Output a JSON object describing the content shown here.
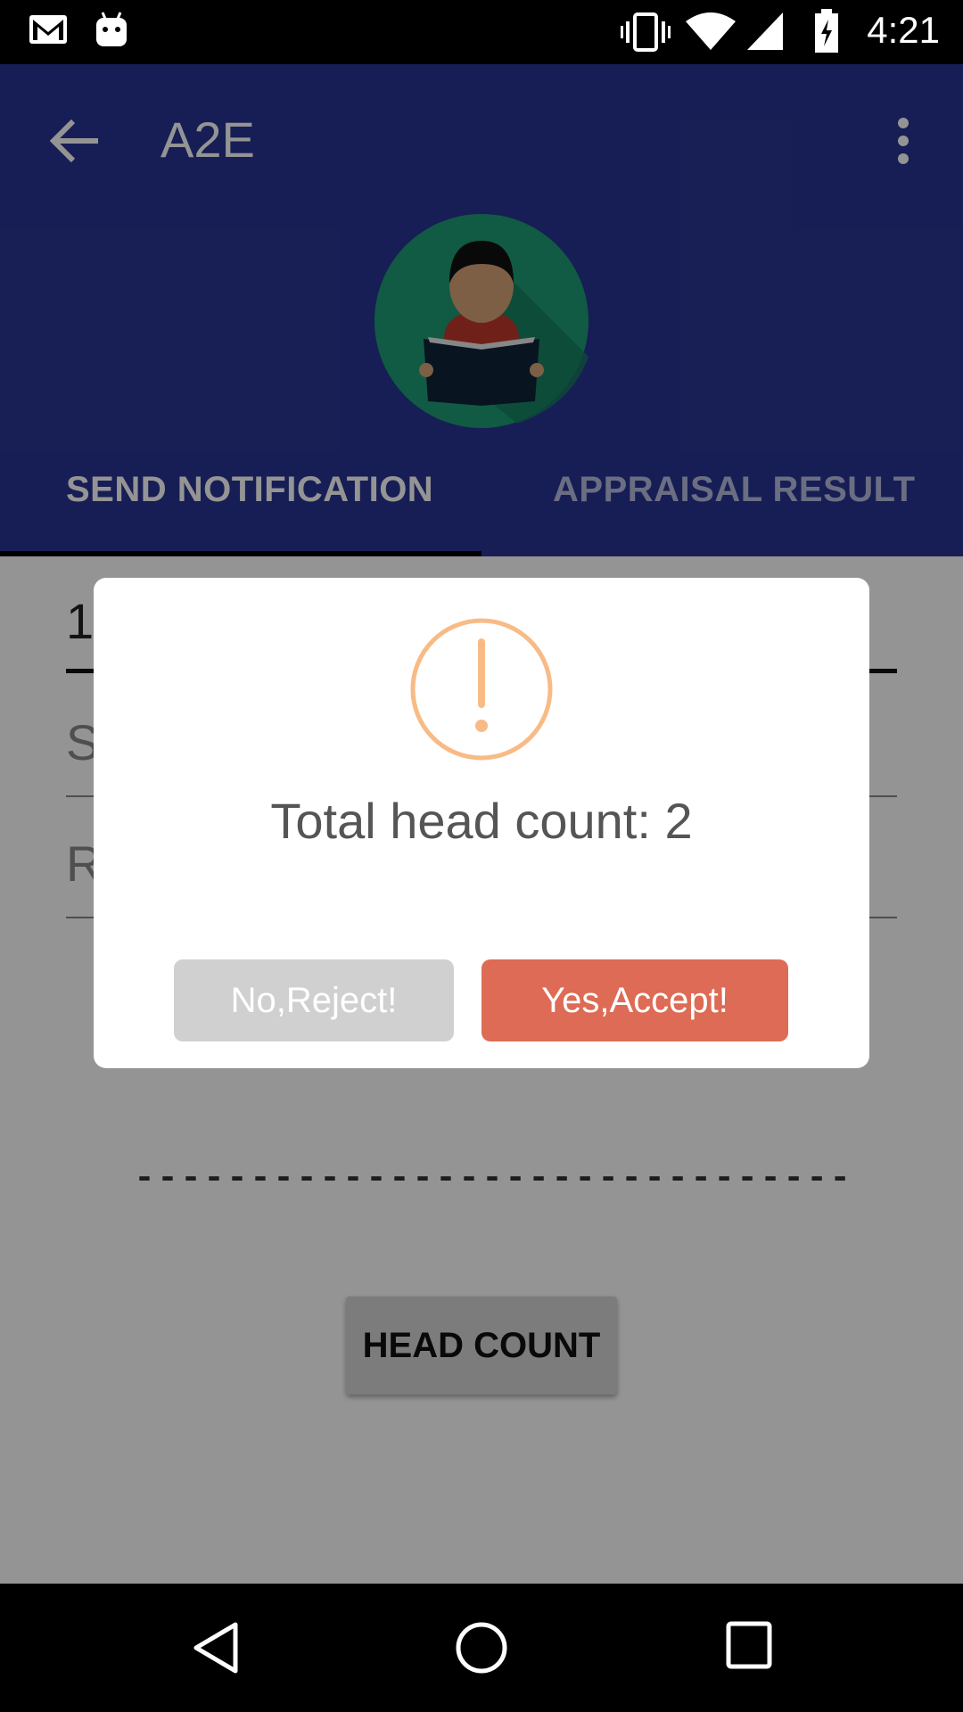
{
  "status_bar": {
    "time": "4:21",
    "icons": [
      "gmail-icon",
      "android-icon",
      "vibrate-icon",
      "wifi-icon",
      "signal-icon",
      "battery-charging-icon"
    ]
  },
  "app_bar": {
    "title": "A2E",
    "back_icon": "arrow-back-icon",
    "menu_icon": "more-vert-icon",
    "avatar_icon": "reader-avatar-icon"
  },
  "tabs": [
    {
      "label": "SEND NOTIFICATION",
      "selected": true
    },
    {
      "label": "APPRAISAL RESULT",
      "selected": false
    }
  ],
  "form": {
    "field1_value": "1",
    "field2_hint": "S",
    "field3_hint": "R",
    "dashes": "-------------------------------",
    "head_count_button": "HEAD COUNT"
  },
  "dialog": {
    "icon": "warning-exclamation-icon",
    "message": "Total head count: 2",
    "reject_label": "No,Reject!",
    "accept_label": "Yes,Accept!",
    "accent_color": "#dd6b55",
    "warning_color": "#f8bb86"
  },
  "nav_bar": {
    "icons": [
      "back-triangle-icon",
      "home-circle-icon",
      "recents-square-icon"
    ]
  }
}
